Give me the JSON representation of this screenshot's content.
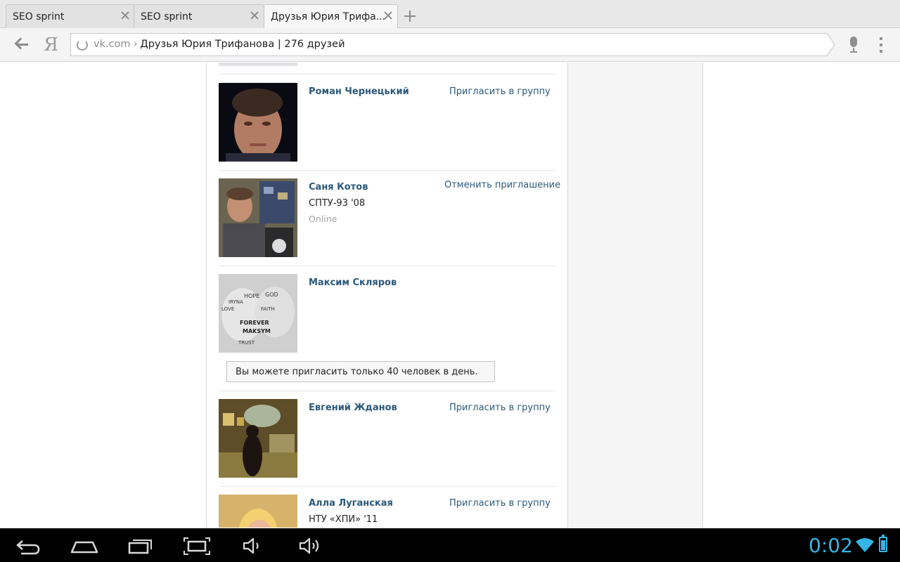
{
  "tabs": [
    {
      "title": "SEO sprint",
      "active": false
    },
    {
      "title": "SEO sprint",
      "active": false
    },
    {
      "title": "Друзья Юрия Трифа...",
      "active": true
    }
  ],
  "omnibox": {
    "host": "vk.com",
    "separator": "›",
    "title": "Друзья Юрия Трифанова | 276 друзей"
  },
  "toolbar": {
    "yandex_glyph": "Я"
  },
  "friends": [
    {
      "name": "Роман Чернецький",
      "subtitle": "",
      "status": "",
      "action": "Пригласить в группу"
    },
    {
      "name": "Саня Котов",
      "subtitle": "СПТУ-93 '08",
      "status": "Online",
      "action": "Отменить приглашение"
    },
    {
      "name": "Максим Скляров",
      "subtitle": "",
      "status": "",
      "action": "",
      "notice": "Вы можете пригласить только 40 человек в день."
    },
    {
      "name": "Евгений Жданов",
      "subtitle": "",
      "status": "",
      "action": "Пригласить в группу"
    },
    {
      "name": "Алла Луганская",
      "subtitle": "НТУ «ХПИ» '11",
      "status": "",
      "action": "Пригласить в группу"
    }
  ],
  "avatar_words": [
    "HOPE",
    "GOD",
    "IRYNA",
    "LOVE",
    "FAITH",
    "FOREVER",
    "MAKSYM",
    "TRUST"
  ],
  "statusbar": {
    "time": "0:02"
  },
  "icons": {
    "back": "arrow-left-icon",
    "reload": "reload-icon",
    "mic": "microphone-icon",
    "menu": "overflow-menu-icon",
    "tab_close": "close-icon",
    "new_tab": "plus-icon"
  },
  "colors": {
    "link": "#2b587a",
    "online": "#a5a5a5",
    "clock": "#33b5e5"
  }
}
